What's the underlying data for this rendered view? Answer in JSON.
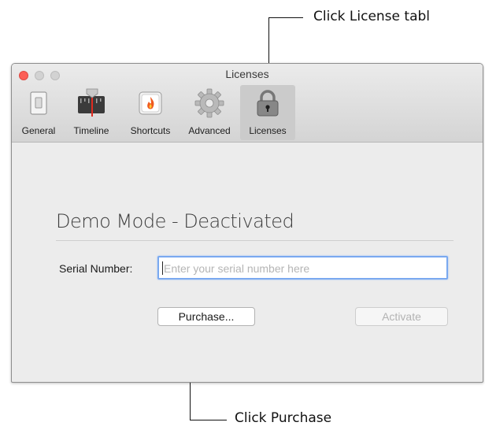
{
  "annotations": {
    "top_callout": "Click License tabl",
    "bottom_callout": "Click Purchase"
  },
  "window": {
    "title": "Licenses",
    "tabs": [
      {
        "label": "General",
        "icon": "switch-icon"
      },
      {
        "label": "Timeline",
        "icon": "timeline-icon"
      },
      {
        "label": "Shortcuts",
        "icon": "flame-icon"
      },
      {
        "label": "Advanced",
        "icon": "gear-icon"
      },
      {
        "label": "Licenses",
        "icon": "padlock-icon",
        "active": true
      }
    ]
  },
  "license": {
    "mode_title": "Demo Mode - Deactivated",
    "serial_label": "Serial Number:",
    "serial_placeholder": "Enter your serial number here",
    "serial_value": "",
    "purchase_label": "Purchase...",
    "activate_label": "Activate"
  },
  "colors": {
    "close_button": "#fc5f57",
    "focus_ring": "#7aa9f0",
    "active_tab": "#cbcbcb"
  }
}
